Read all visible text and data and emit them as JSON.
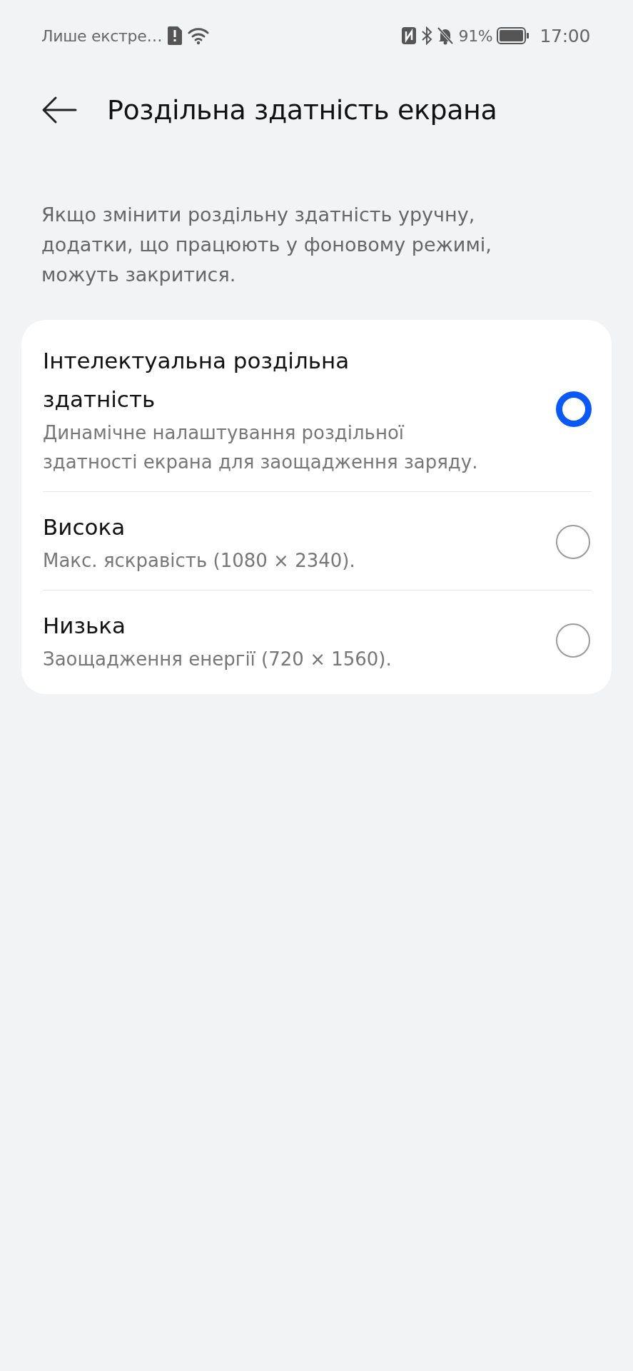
{
  "status_bar": {
    "carrier": "Лише екстре…",
    "battery_percent": "91%",
    "time": "17:00"
  },
  "header": {
    "title": "Роздільна здатність екрана"
  },
  "description": "Якщо змінити роздільну здатність уручну, додатки, що працюють у фоновому режимі, можуть закритися.",
  "options": [
    {
      "title": "Інтелектуальна роздільна здатність",
      "subtitle": "Динамічне налаштування роздільної здатності екрана для заощадження заряду.",
      "selected": true
    },
    {
      "title": "Висока",
      "subtitle": "Макс. яскравість (1080 × 2340).",
      "selected": false
    },
    {
      "title": "Низька",
      "subtitle": "Заощадження енергії (720 × 1560).",
      "selected": false
    }
  ]
}
